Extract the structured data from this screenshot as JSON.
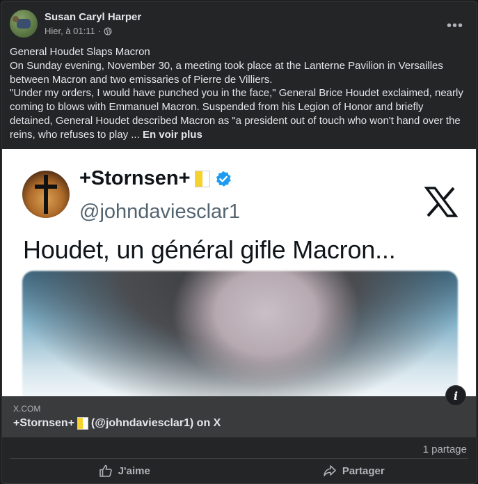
{
  "post": {
    "author": "Susan Caryl Harper",
    "time": "Hier, à 01:11",
    "separator": "·",
    "more_label": "•••",
    "text_lines": [
      "General Houdet Slaps Macron",
      "On Sunday evening, November 30, a meeting took place at the Lanterne Pavilion in Versailles between Macron and two emissaries of Pierre de Villiers.",
      "\"Under my orders, I would have punched you in the face,\" General Brice Houdet exclaimed, nearly coming to blows with Emmanuel Macron. Suspended from his Legion of Honor and briefly detained, General Houdet described Macron as \"a president out of touch who won't hand over the reins, who refuses to play ..."
    ],
    "see_more": "En voir plus"
  },
  "tweet": {
    "name": "+Stornsen+",
    "handle": "@johndaviesclar1",
    "text": "Houdet, un général gifle Macron..."
  },
  "link": {
    "domain": "X.COM",
    "title_prefix": "+Stornsen+",
    "title_suffix": "(@johndaviesclar1) on X",
    "info_label": "i"
  },
  "stats": {
    "shares": "1 partage"
  },
  "actions": {
    "like": "J'aime",
    "share": "Partager"
  },
  "colors": {
    "background": "#18191a",
    "card": "#242526",
    "link_footer": "#3a3b3c",
    "verified": "#1d9bf0"
  },
  "icons": [
    "globe-icon",
    "more-icon",
    "verified-icon",
    "x-logo-icon",
    "info-icon",
    "like-icon",
    "share-icon"
  ]
}
